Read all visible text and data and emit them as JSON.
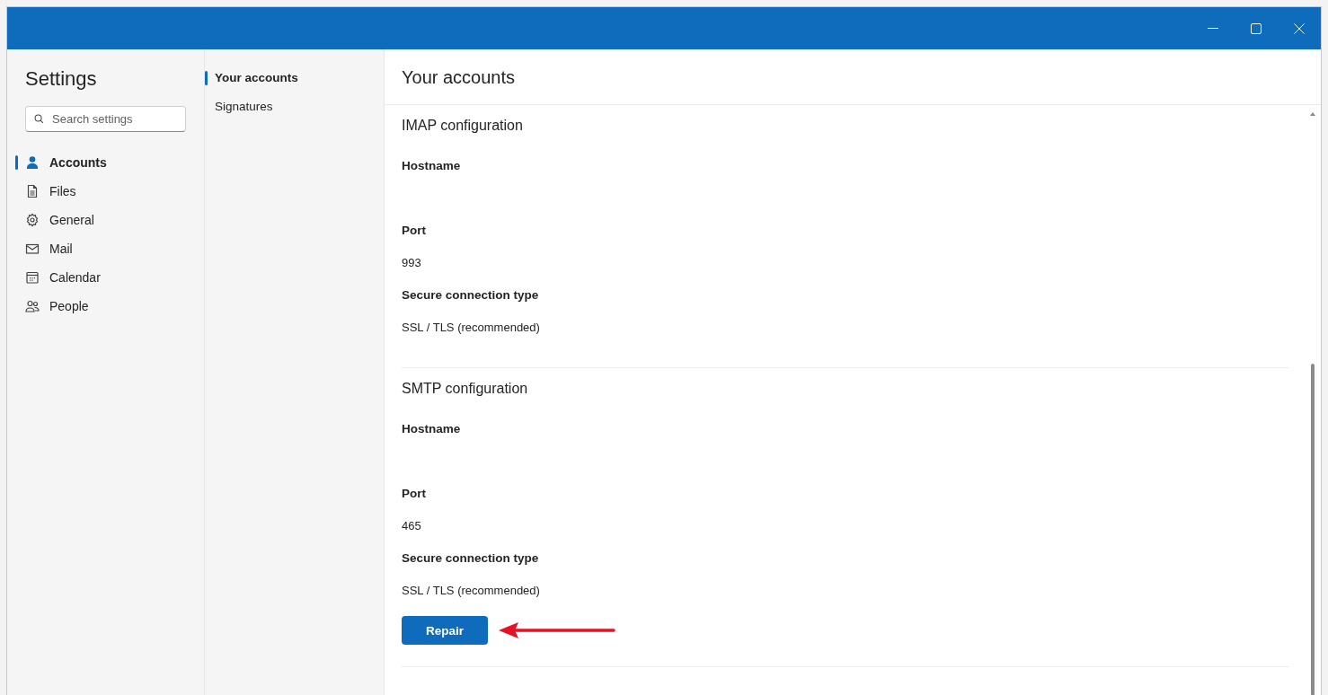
{
  "window": {
    "controls": [
      {
        "kind": "minimize"
      },
      {
        "kind": "maximize"
      },
      {
        "kind": "close"
      }
    ]
  },
  "sidebar": {
    "title": "Settings",
    "search": {
      "placeholder": "Search settings"
    },
    "items": [
      {
        "label": "Accounts",
        "kind": "person",
        "selected": true
      },
      {
        "label": "Files",
        "kind": "file",
        "selected": false
      },
      {
        "label": "General",
        "kind": "gear",
        "selected": false
      },
      {
        "label": "Mail",
        "kind": "mail",
        "selected": false
      },
      {
        "label": "Calendar",
        "kind": "calendar",
        "selected": false
      },
      {
        "label": "People",
        "kind": "people",
        "selected": false
      }
    ]
  },
  "subnav": {
    "items": [
      {
        "label": "Your accounts",
        "selected": true
      },
      {
        "label": "Signatures",
        "selected": false
      }
    ]
  },
  "content": {
    "title": "Your accounts",
    "sections": [
      {
        "title": "IMAP configuration",
        "fields": [
          {
            "label": "Hostname"
          },
          {
            "label": "Port",
            "value": "993"
          },
          {
            "label": "Secure connection type",
            "value": "SSL / TLS (recommended)"
          }
        ]
      },
      {
        "title": "SMTP configuration",
        "fields": [
          {
            "label": "Hostname"
          },
          {
            "label": "Port",
            "value": "465"
          },
          {
            "label": "Secure connection type",
            "value": "SSL / TLS (recommended)"
          }
        ],
        "button": "Repair"
      }
    ]
  }
}
